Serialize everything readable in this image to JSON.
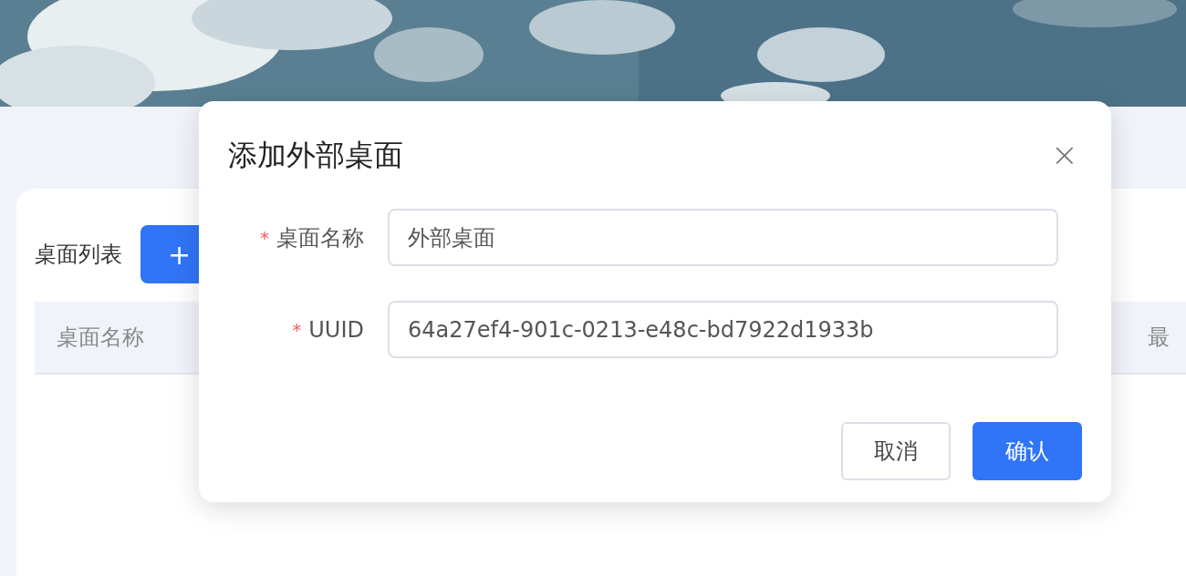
{
  "list": {
    "title": "桌面列表",
    "add_button": "+",
    "table": {
      "columns": [
        "桌面名称",
        "最"
      ]
    }
  },
  "dialog": {
    "title": "添加外部桌面",
    "close": "×",
    "fields": [
      {
        "label": "桌面名称",
        "required": true,
        "required_mark": "*",
        "value": "外部桌面"
      },
      {
        "label": "UUID",
        "required": true,
        "required_mark": "*",
        "value": "64a27ef4-901c-0213-e48c-bd7922d1933b"
      }
    ],
    "buttons": [
      {
        "label": "取消",
        "kind": "secondary"
      },
      {
        "label": "确认",
        "kind": "primary"
      }
    ]
  }
}
